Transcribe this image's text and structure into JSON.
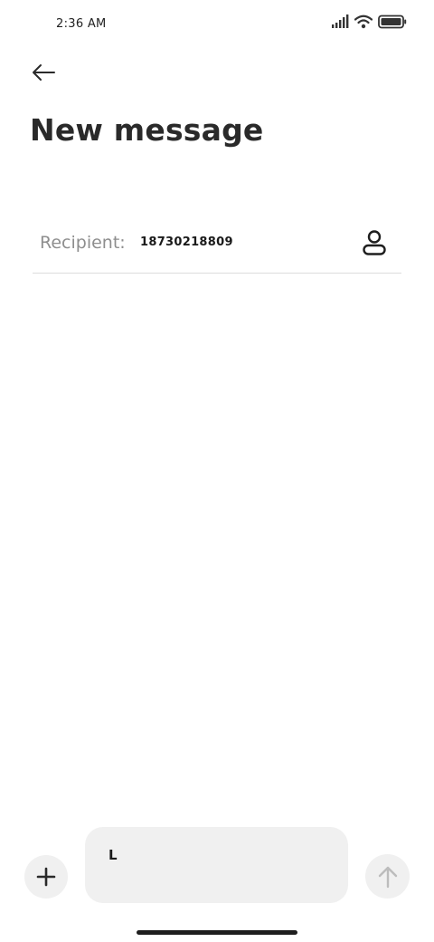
{
  "status_bar": {
    "time": "2:36 AM",
    "icons": [
      "signal-icon",
      "wifi-icon",
      "battery-icon"
    ]
  },
  "header": {
    "back_icon": "back-arrow-icon",
    "title": "New message"
  },
  "recipient": {
    "label": "Recipient:",
    "value": "18730218809",
    "contact_icon": "contact-person-icon"
  },
  "compose": {
    "add_icon": "plus-icon",
    "message_text": "L",
    "send_icon": "arrow-up-icon"
  },
  "colors": {
    "background": "#ffffff",
    "text": "#222222",
    "muted": "#8e8e8e",
    "input_bg": "#f0f0f0",
    "divider": "#dcdcdc"
  }
}
